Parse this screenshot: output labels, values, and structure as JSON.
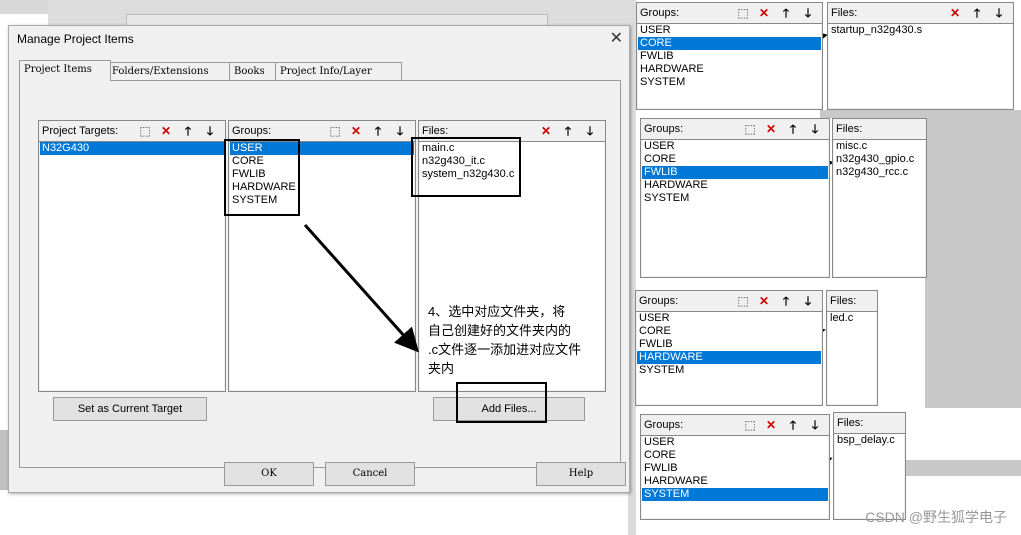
{
  "dialog": {
    "title": "Manage Project Items",
    "tabs": [
      "Project Items",
      "Folders/Extensions",
      "Books",
      "Project Info/Layer"
    ],
    "targets_label": "Project Targets:",
    "targets": [
      "N32G430"
    ],
    "groups_label": "Groups:",
    "groups": [
      "USER",
      "CORE",
      "FWLIB",
      "HARDWARE",
      "SYSTEM"
    ],
    "files_label": "Files:",
    "files": [
      "main.c",
      "n32g430_it.c",
      "system_n32g430.c"
    ],
    "set_target_btn": "Set as Current Target",
    "add_files_btn": "Add Files...",
    "ok_btn": "OK",
    "cancel_btn": "Cancel",
    "help_btn": "Help"
  },
  "annotation": {
    "line1": "4、选中对应文件夹，将",
    "line2": "自己创建好的文件夹内的",
    "line3": ".c文件逐一添加进对应文件",
    "line4": "夹内"
  },
  "mini_panels": [
    {
      "groups_label": "Groups:",
      "files_label": "Files:",
      "selected": "CORE",
      "files": [
        "startup_n32g430.s"
      ]
    },
    {
      "groups_label": "Groups:",
      "files_label": "Files:",
      "selected": "FWLIB",
      "files": [
        "misc.c",
        "n32g430_gpio.c",
        "n32g430_rcc.c"
      ]
    },
    {
      "groups_label": "Groups:",
      "files_label": "Files:",
      "selected": "HARDWARE",
      "files": [
        "led.c"
      ]
    },
    {
      "groups_label": "Groups:",
      "files_label": "Files:",
      "selected": "SYSTEM",
      "files": [
        "bsp_delay.c"
      ]
    }
  ],
  "watermark": "CSDN @野生狐学电子",
  "colors": {
    "selection": "#0078d7",
    "accent_red": "#cc0000"
  }
}
